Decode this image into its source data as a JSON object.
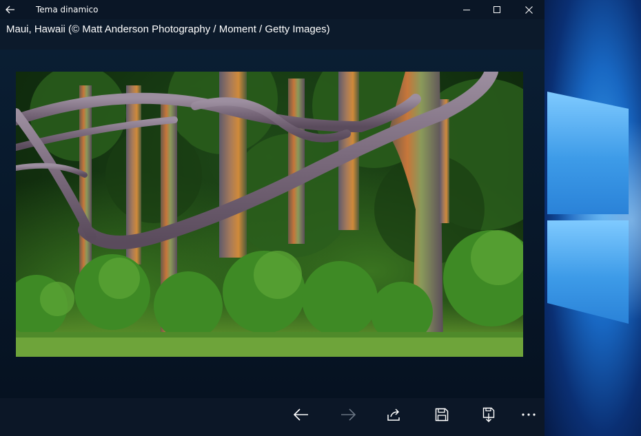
{
  "window": {
    "title": "Tema dinamico",
    "back_icon": "back-arrow-icon",
    "controls": {
      "minimize": "minimize-icon",
      "maximize": "maximize-icon",
      "close": "close-icon"
    }
  },
  "image": {
    "caption": "Maui, Hawaii (© Matt Anderson Photography / Moment / Getty Images)",
    "subject": "rainbow eucalyptus forest"
  },
  "commands": [
    {
      "name": "previous",
      "icon": "arrow-left-icon",
      "enabled": true
    },
    {
      "name": "next",
      "icon": "arrow-right-icon",
      "enabled": false
    },
    {
      "name": "share",
      "icon": "share-icon",
      "enabled": true
    },
    {
      "name": "save",
      "icon": "save-icon",
      "enabled": true
    },
    {
      "name": "set-lock-screen",
      "icon": "save-download-icon",
      "enabled": true
    },
    {
      "name": "more",
      "icon": "more-icon",
      "enabled": true
    }
  ],
  "colors": {
    "app_background": "#081525",
    "titlebar": "#0a1626",
    "desktop_accent": "#1867c2",
    "disabled_icon": "#6b7684"
  }
}
